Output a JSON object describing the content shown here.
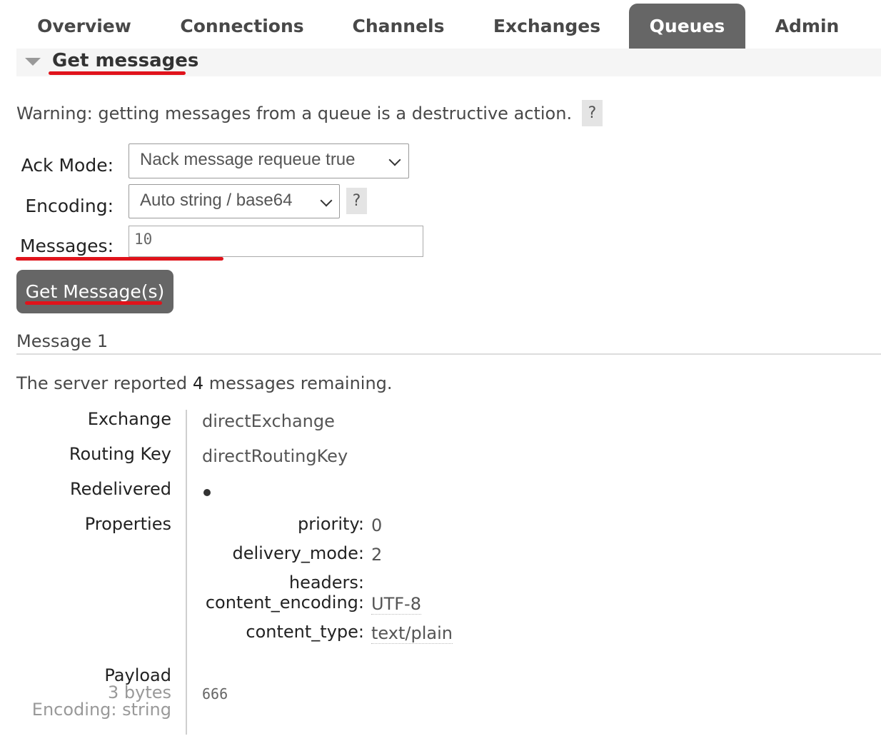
{
  "nav": {
    "tabs": [
      {
        "label": "Overview"
      },
      {
        "label": "Connections"
      },
      {
        "label": "Channels"
      },
      {
        "label": "Exchanges"
      },
      {
        "label": "Queues"
      },
      {
        "label": "Admin"
      }
    ],
    "active_tab": "Queues"
  },
  "section": {
    "title": "Get messages"
  },
  "warning": {
    "text": "Warning: getting messages from a queue is a destructive action.",
    "help": "?"
  },
  "form": {
    "ack_mode_label": "Ack Mode:",
    "ack_mode_value": "Nack message requeue true",
    "encoding_label": "Encoding:",
    "encoding_value": "Auto string / base64",
    "encoding_help": "?",
    "messages_label": "Messages:",
    "messages_value": "10",
    "get_button": "Get Message(s)"
  },
  "message": {
    "heading": "Message 1",
    "remaining_prefix": "The server reported",
    "remaining_count": "4",
    "remaining_suffix": "messages remaining.",
    "exchange_label": "Exchange",
    "exchange_value": "directExchange",
    "routing_key_label": "Routing Key",
    "routing_key_value": "directRoutingKey",
    "redelivered_label": "Redelivered",
    "properties_label": "Properties",
    "properties": {
      "priority_label": "priority:",
      "priority_value": "0",
      "delivery_mode_label": "delivery_mode:",
      "delivery_mode_value": "2",
      "headers_label": "headers:",
      "content_encoding_label": "content_encoding:",
      "content_encoding_value": "UTF-8",
      "content_type_label": "content_type:",
      "content_type_value": "text/plain"
    },
    "payload_label": "Payload",
    "payload_size": "3 bytes",
    "payload_encoding": "Encoding: string",
    "payload_value": "666"
  },
  "colors": {
    "accent_tab": "#666666",
    "highlight_underline": "#e0131b"
  }
}
